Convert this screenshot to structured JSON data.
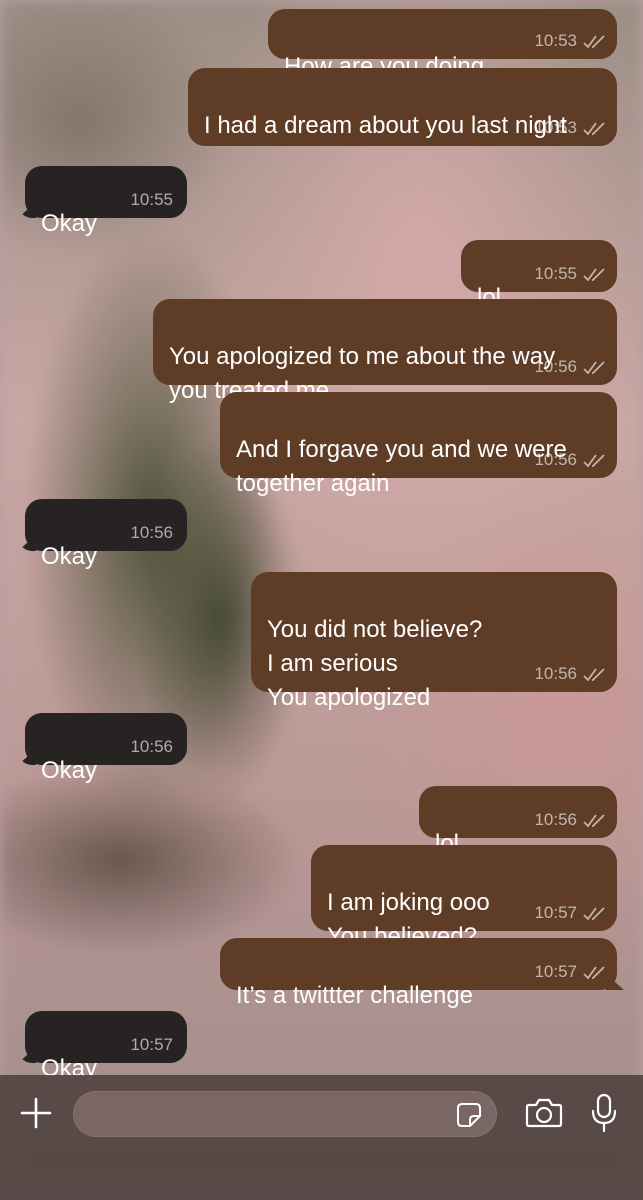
{
  "messages": [
    {
      "dir": "out",
      "text": "How are you doing",
      "time": "10:53",
      "read": true
    },
    {
      "dir": "out",
      "text": "I had a dream about you last night",
      "time": "10:53",
      "read": true
    },
    {
      "dir": "in",
      "text": "Okay",
      "time": "10:55"
    },
    {
      "dir": "out",
      "text": "lol",
      "time": "10:55",
      "read": true
    },
    {
      "dir": "out",
      "text": "You apologized to me about the way\nyou treated me",
      "time": "10:56",
      "read": true
    },
    {
      "dir": "out",
      "text": "And I forgave you and we were\ntogether again",
      "time": "10:56",
      "read": true
    },
    {
      "dir": "in",
      "text": "Okay",
      "time": "10:56"
    },
    {
      "dir": "out",
      "text": "You did not believe?\nI am serious\nYou apologized",
      "time": "10:56",
      "read": true
    },
    {
      "dir": "in",
      "text": "Okay",
      "time": "10:56"
    },
    {
      "dir": "out",
      "text": "lol",
      "emoji": "😂",
      "time": "10:56",
      "read": true
    },
    {
      "dir": "out",
      "text": "I am joking ooo\nYou believed?",
      "time": "10:57",
      "read": true
    },
    {
      "dir": "out",
      "text": "It’s a twittter challenge",
      "time": "10:57",
      "read": true
    },
    {
      "dir": "in",
      "text": "Okay",
      "time": "10:57"
    }
  ],
  "composer": {
    "input_value": "",
    "icons": [
      "plus-icon",
      "sticker-icon",
      "camera-icon",
      "microphone-icon"
    ]
  },
  "colors": {
    "outgoing_bubble": "#5e3c26",
    "incoming_bubble": "#262322",
    "timestamp": "#bfb3ad"
  }
}
